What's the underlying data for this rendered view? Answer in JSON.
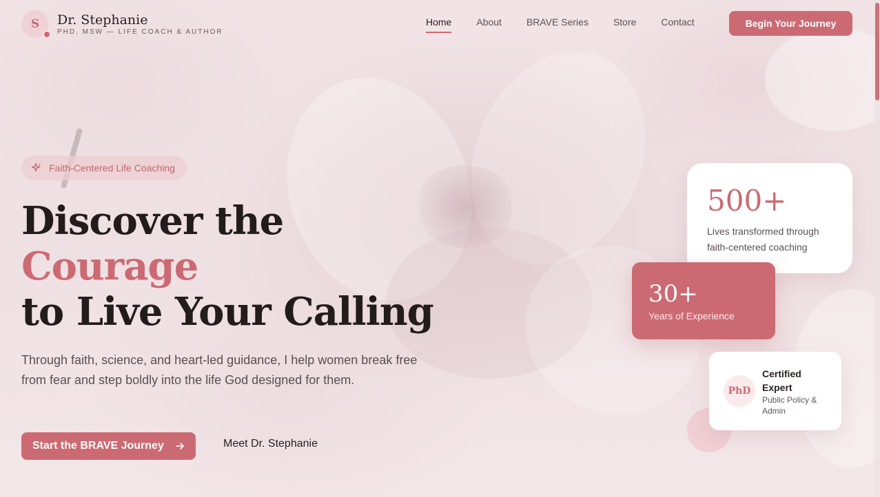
{
  "brand": {
    "initial": "S",
    "name": "Dr. Stephanie",
    "subtitle": "PHD, MSW — LIFE COACH & AUTHOR"
  },
  "nav": {
    "items": [
      {
        "label": "Home",
        "active": true
      },
      {
        "label": "About",
        "active": false
      },
      {
        "label": "BRAVE Series",
        "active": false
      },
      {
        "label": "Store",
        "active": false
      },
      {
        "label": "Contact",
        "active": false
      }
    ],
    "cta_label": "Begin Your Journey"
  },
  "hero": {
    "badge": "Faith-Centered Life Coaching",
    "headline_line1": "Discover the",
    "headline_accent": "Courage",
    "headline_line3": "to Live Your Calling",
    "lead": "Through faith, science, and heart-led guidance, I help women break free from fear and step boldly into the life God designed for them.",
    "primary_button": "Start the BRAVE Journey",
    "secondary_button": "Meet Dr. Stephanie"
  },
  "stats": {
    "lives": {
      "number": "500+",
      "description": "Lives transformed through faith-centered coaching"
    },
    "experience": {
      "number": "30+",
      "description": "Years of Experience"
    },
    "credential": {
      "badge": "PhD",
      "title": "Certified Expert",
      "subtitle": "Public Policy & Admin"
    }
  },
  "colors": {
    "accent": "#cc6a73",
    "text_dark": "#231c1c",
    "background": "#f4e8ea"
  }
}
